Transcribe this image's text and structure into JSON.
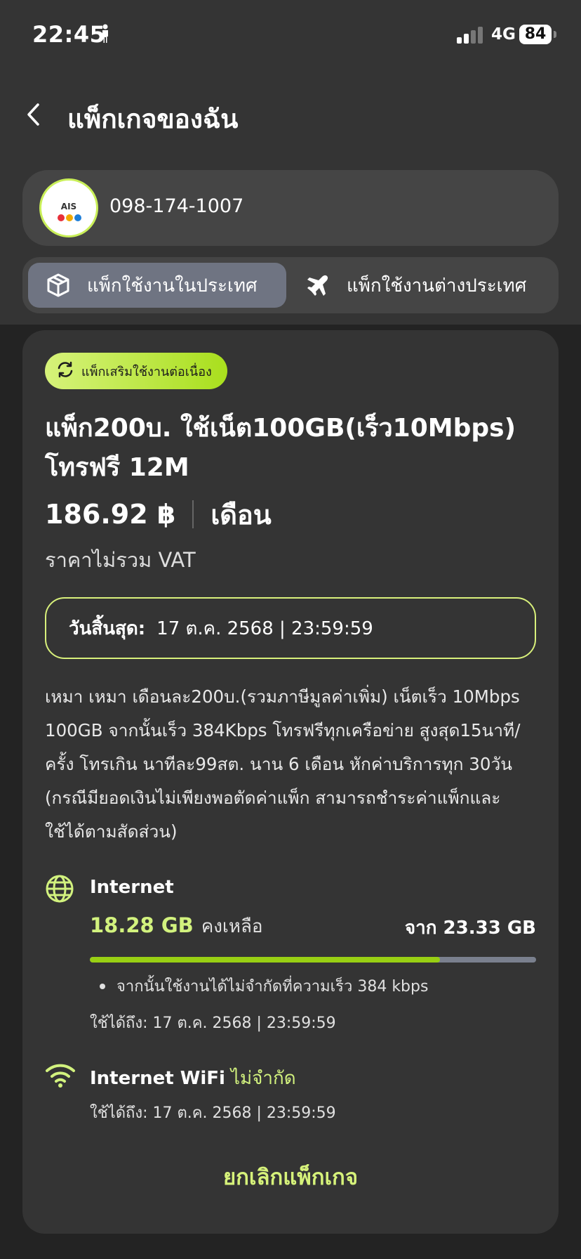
{
  "status_bar": {
    "time": "22:45",
    "network": "4G",
    "battery": "84"
  },
  "header": {
    "title": "แพ็กเกจของฉัน"
  },
  "account": {
    "logo_text": "AIS",
    "phone_number": "098-174-1007"
  },
  "tabs": [
    {
      "label": "แพ็กใช้งานในประเทศ",
      "icon": "box-icon",
      "active": true
    },
    {
      "label": "แพ็กใช้งานต่างประเทศ",
      "icon": "airplane-icon",
      "active": false
    }
  ],
  "package": {
    "badge": "แพ็กเสริมใช้งานต่อเนื่อง",
    "title": "แพ็ก200บ. ใช้เน็ต100GB(เร็ว10Mbps) โทรฟรี 12M",
    "price": "186.92 ฿",
    "price_unit": "เดือน",
    "vat_note": "ราคาไม่รวม VAT",
    "expiry_label": "วันสิ้นสุด:",
    "expiry_value": "17 ต.ค. 2568 | 23:59:59",
    "description": "เหมา เหมา เดือนละ200บ.(รวมภาษีมูลค่าเพิ่ม) เน็ตเร็ว 10Mbps 100GB จากนั้นเร็ว 384Kbps โทรฟรีทุกเครือข่าย สูงสุด15นาที/ครั้ง โทรเกิน นาทีละ99สต. นาน 6 เดือน หักค่าบริการทุก 30วัน (กรณีมียอดเงินไม่เพียงพอตัดค่าแพ็ก สามารถชำระค่าแพ็กและใช้ได้ตามสัดส่วน)"
  },
  "internet": {
    "title": "Internet",
    "remaining": "18.28 GB",
    "remaining_label": "คงเหลือ",
    "total": "จาก 23.33 GB",
    "remaining_fraction": 0.784,
    "note": "จากนั้นใช้งานได้ไม่จำกัดที่ความเร็ว 384 kbps",
    "valid_until": "ใช้ได้ถึง: 17 ต.ค. 2568 | 23:59:59"
  },
  "wifi": {
    "title": "Internet WiFi",
    "unlimited": "ไม่จำกัด",
    "valid_until": "ใช้ได้ถึง: 17 ต.ค. 2568 | 23:59:59"
  },
  "actions": {
    "cancel": "ยกเลิกแพ็กเกจ"
  },
  "colors": {
    "accent": "#d2f27e",
    "progress": "#98cf13",
    "card": "#343434",
    "background": "#232323"
  }
}
